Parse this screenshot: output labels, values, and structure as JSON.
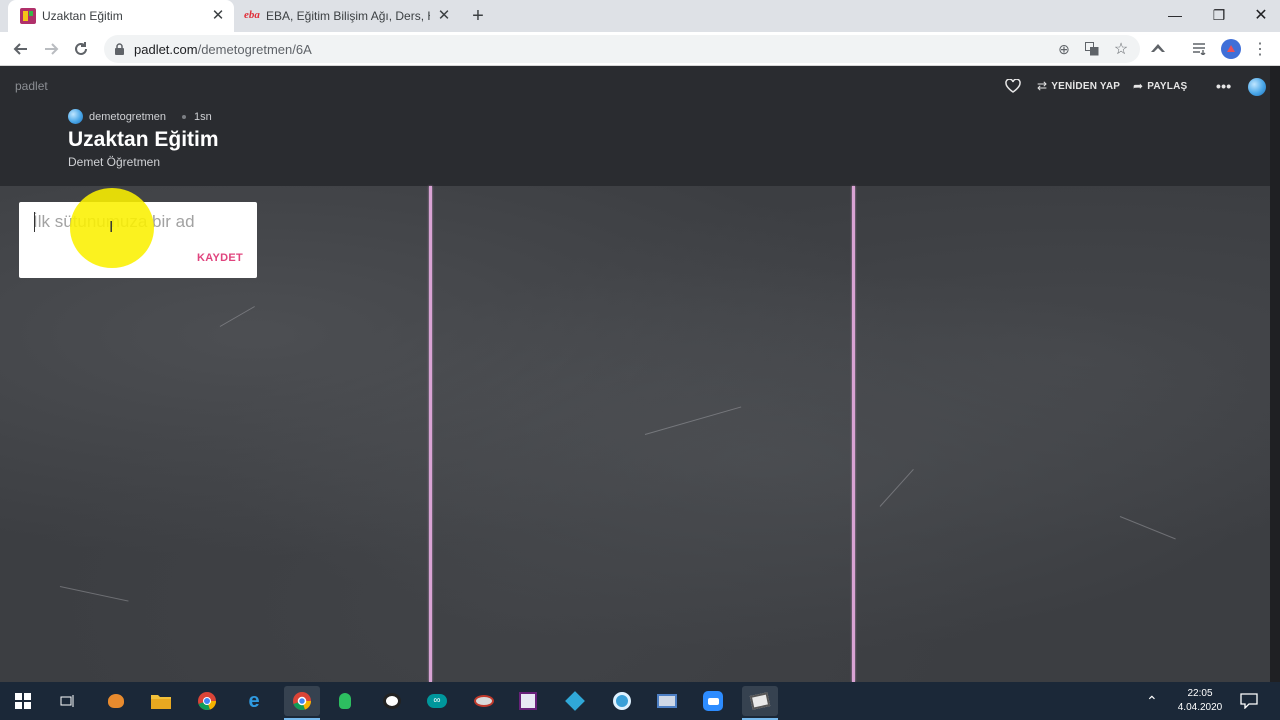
{
  "browser": {
    "tabs": [
      {
        "title": "Uzaktan Eğitim",
        "active": true,
        "favicon": "padlet-favicon"
      },
      {
        "title": "EBA, Eğitim Bilişim Ağı, Ders, Hab",
        "active": false,
        "favicon": "eba-favicon",
        "favicon_text": "eba"
      }
    ],
    "url_host": "padlet.com",
    "url_path": "/demetogretmen/6A"
  },
  "padlet": {
    "brand": "padlet",
    "actions": {
      "remake": "YENİDEN YAP",
      "share": "PAYLAŞ"
    },
    "author": "demetogretmen",
    "time": "1sn",
    "title": "Uzaktan Eğitim",
    "subtitle": "Demet Öğretmen"
  },
  "column_form": {
    "placeholder": "İlk sütunumuza bir ad",
    "save_label": "KAYDET"
  },
  "colors": {
    "accent": "#e0447e",
    "chalk_line": "#d9a3d4",
    "highlight": "#faf000"
  },
  "taskbar": {
    "time": "22:05",
    "date": "4.04.2020",
    "apps": [
      "windows-start-icon",
      "task-view-icon",
      "app-icon",
      "file-explorer-icon",
      "chrome-icon",
      "edge-icon",
      "chrome-profile-icon",
      "evernote-icon",
      "panda-icon",
      "arduino-icon",
      "paint-app-icon",
      "visual-studio-icon",
      "kodi-icon",
      "settings-app-icon",
      "remote-desktop-icon",
      "zoom-icon",
      "app-icon"
    ]
  }
}
